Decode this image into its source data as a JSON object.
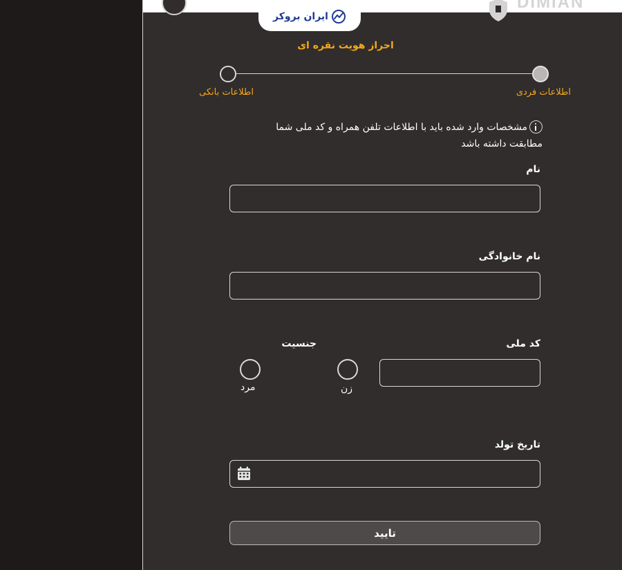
{
  "header": {
    "brand_logo_text": "ایران بروکر",
    "corner_brand_text": "DIMIAN"
  },
  "page": {
    "title": "احراز هویت نقره ای"
  },
  "stepper": {
    "steps": [
      {
        "label": "اطلاعات فردی",
        "active": true
      },
      {
        "label": "اطلاعات بانکی",
        "active": false
      }
    ]
  },
  "notice": {
    "text": "مشخصات وارد شده باید با اطلاعات تلفن همراه و کد ملی شما مطابقت داشته باشد",
    "icon": "info-icon"
  },
  "form": {
    "first_name": {
      "label": "نام",
      "value": ""
    },
    "last_name": {
      "label": "نام خانوادگی",
      "value": ""
    },
    "national_code": {
      "label": "کد ملی",
      "value": ""
    },
    "gender": {
      "label": "جنسیت",
      "options": [
        {
          "label": "زن",
          "selected": false
        },
        {
          "label": "مرد",
          "selected": false
        }
      ]
    },
    "birth_date": {
      "label": "تاریخ تولد",
      "value": "",
      "icon": "calendar-icon"
    },
    "submit_label": "تایید"
  },
  "colors": {
    "background": "#302d2c",
    "sidebar": "#1e1a1a",
    "accent": "#f6a81c",
    "logo_blue": "#1f3a93",
    "border": "#d9d9d9",
    "button_bg": "#4d4a49"
  }
}
